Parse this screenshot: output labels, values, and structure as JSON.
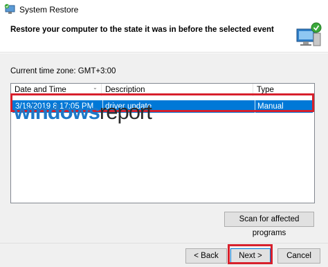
{
  "window": {
    "title": "System Restore",
    "icon": "system-restore-icon"
  },
  "header": {
    "text": "Restore your computer to the state it was in before the selected event",
    "icon": "computer-restore-icon"
  },
  "timezone": {
    "label": "Current time zone: GMT+3:00"
  },
  "list": {
    "columns": [
      "Date and Time",
      "Description",
      "Type"
    ],
    "rows": [
      {
        "date": "3/19/2019 8:17:05 PM",
        "description": "driver update",
        "type": "Manual",
        "selected": true
      }
    ]
  },
  "watermark": {
    "part1": "windows",
    "part2": "report"
  },
  "buttons": {
    "scan": "Scan for affected programs",
    "back": "< Back",
    "next": "Next >",
    "cancel": "Cancel"
  },
  "colors": {
    "selection": "#0078d7",
    "highlight": "#d7202c",
    "watermark_blue": "#1d78c8"
  }
}
